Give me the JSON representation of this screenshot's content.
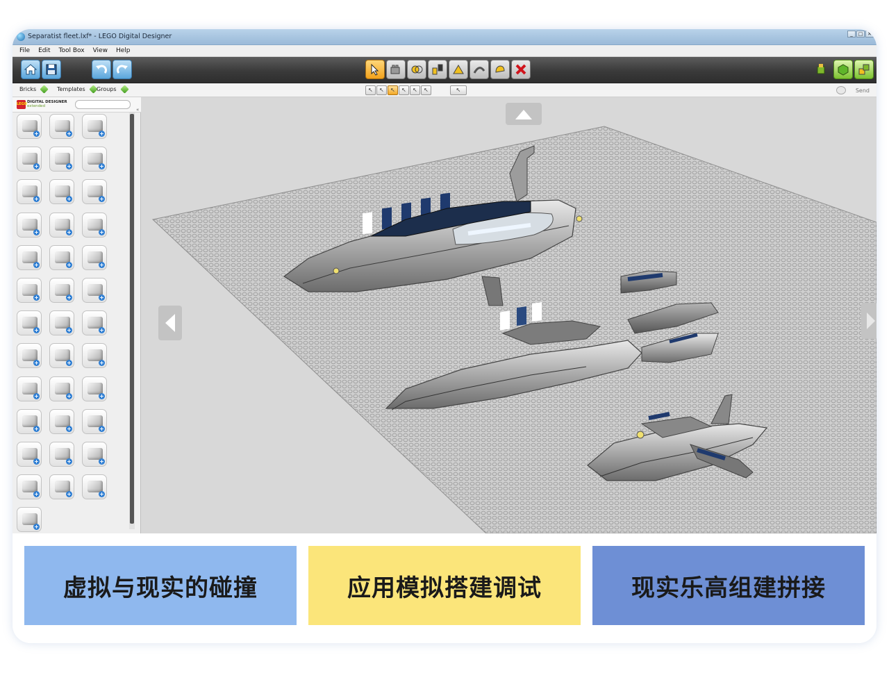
{
  "window": {
    "title": "Separatist fleet.lxf* - LEGO Digital Designer",
    "buttons": [
      "_",
      "□",
      "✕"
    ]
  },
  "menu": [
    "File",
    "Edit",
    "Tool Box",
    "View",
    "Help"
  ],
  "toolbar": {
    "left_icons": [
      "home-icon",
      "save-icon",
      "undo-icon",
      "redo-icon"
    ],
    "center_icons": [
      "select-arrow-icon",
      "add-brick-icon",
      "clone-icon",
      "hinge-icon",
      "hinge-align-icon",
      "flex-icon",
      "paint-icon",
      "delete-icon"
    ],
    "right_icons": [
      "build-mode-icon",
      "view-mode-icon",
      "building-guide-icon"
    ]
  },
  "subbar": {
    "tabs": [
      "Bricks",
      "Templates",
      "Groups"
    ],
    "send_label": "Send"
  },
  "palette": {
    "header_line1": "DIGITAL DESIGNER",
    "header_line2": "extended",
    "logo_text": "LEGO",
    "collapse_glyph": "«"
  },
  "labels": [
    "虚拟与现实的碰撞",
    "应用模拟搭建调试",
    "现实乐高组建拼接"
  ]
}
